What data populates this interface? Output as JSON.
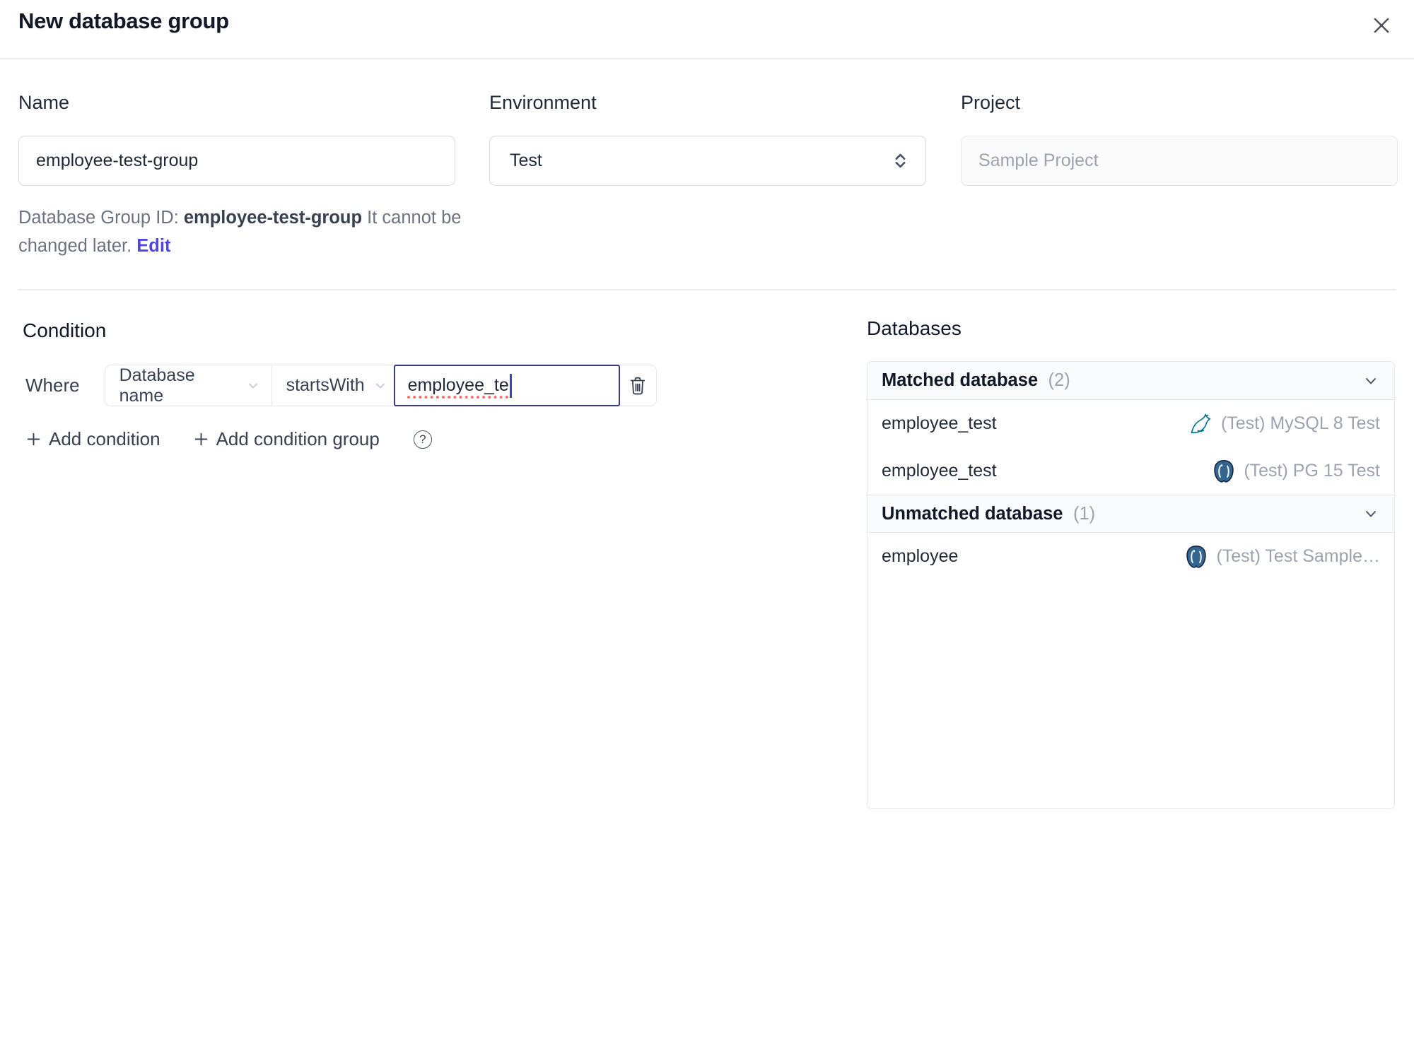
{
  "dialog": {
    "title": "New database group"
  },
  "form": {
    "name": {
      "label": "Name",
      "value": "employee-test-group"
    },
    "environment": {
      "label": "Environment",
      "value": "Test"
    },
    "project": {
      "label": "Project",
      "value": "Sample Project"
    },
    "group_id_note": {
      "prefix": "Database Group ID: ",
      "id": "employee-test-group",
      "suffix": " It cannot be changed later. ",
      "edit_link": "Edit"
    }
  },
  "condition": {
    "heading": "Condition",
    "where_label": "Where",
    "field_selected": "Database name",
    "operator_selected": "startsWith",
    "value": "employee_te",
    "add_condition_label": "Add condition",
    "add_condition_group_label": "Add condition group",
    "help_glyph": "?"
  },
  "databases": {
    "heading": "Databases",
    "matched": {
      "label": "Matched database",
      "count": "(2)",
      "rows": [
        {
          "name": "employee_test",
          "engine": "mysql",
          "instance": "(Test) MySQL 8 Test"
        },
        {
          "name": "employee_test",
          "engine": "postgresql",
          "instance": "(Test) PG 15 Test"
        }
      ]
    },
    "unmatched": {
      "label": "Unmatched database",
      "count": "(1)",
      "rows": [
        {
          "name": "employee",
          "engine": "postgresql",
          "instance": "(Test) Test Sample…"
        }
      ]
    }
  },
  "colors": {
    "accent_link": "#4f46e5",
    "focus_border": "#3b3b8c",
    "spellcheck_underline": "#f87171",
    "mysql_teal": "#00758f",
    "postgres_blue": "#336791",
    "muted_text": "#9ca3af",
    "section_header_bg": "#f9fafb",
    "border": "#e5e7eb"
  }
}
